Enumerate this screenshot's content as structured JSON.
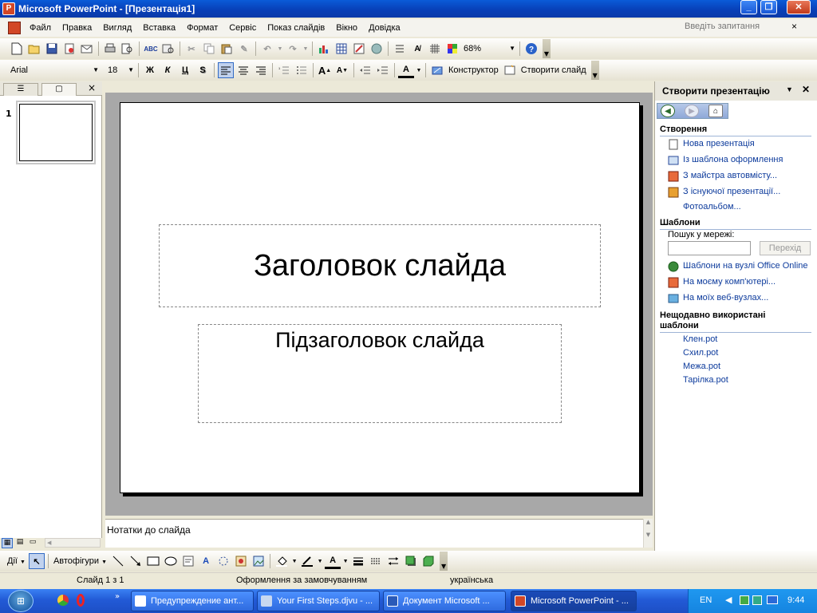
{
  "window": {
    "title": "Microsoft PowerPoint - [Презентація1]",
    "app_icon_letter": "P"
  },
  "menu": {
    "items": [
      "Файл",
      "Правка",
      "Вигляд",
      "Вставка",
      "Формат",
      "Сервіс",
      "Показ слайдів",
      "Вікно",
      "Довідка"
    ],
    "help_placeholder": "Введіть запитання",
    "close_symbol": "×"
  },
  "standard_toolbar": {
    "zoom": "68%"
  },
  "formatting_toolbar": {
    "font": "Arial",
    "size": "18",
    "bold": "Ж",
    "italic": "К",
    "underline": "Ц",
    "shadow": "S",
    "designer_label": "Конструктор",
    "new_slide_label": "Створити слайд"
  },
  "slides_panel": {
    "slide_number": "1",
    "close_symbol": "×"
  },
  "slide": {
    "title_placeholder": "Заголовок слайда",
    "subtitle_placeholder": "Підзаголовок слайда"
  },
  "notes": {
    "placeholder": "Нотатки до слайда"
  },
  "task_pane": {
    "title": "Створити презентацію",
    "section_new": "Створення",
    "new_links": [
      "Нова презентація",
      "Із шаблона оформлення",
      "З майстра автовмісту...",
      "З існуючої презентації...",
      "Фотоальбом..."
    ],
    "section_templates": "Шаблони",
    "search_label": "Пошук у мережі:",
    "go_button": "Перехід",
    "template_links": [
      "Шаблони на вузлі Office Online",
      "На моєму комп'ютері...",
      "На моїх веб-вузлах..."
    ],
    "section_recent": "Нещодавно використані шаблони",
    "recent_templates": [
      "Клен.pot",
      "Схил.pot",
      "Межа.pot",
      "Тарілка.pot"
    ]
  },
  "drawing_toolbar": {
    "actions_label": "Дії",
    "autoshapes_label": "Автофігури"
  },
  "status_bar": {
    "slide": "Слайд 1 з 1",
    "design": "Оформлення за замовчуванням",
    "language": "українська"
  },
  "taskbar": {
    "tasks": [
      "Предупреждение ант...",
      "Your First Steps.djvu - ...",
      "Документ Microsoft ...",
      "Microsoft PowerPoint - ..."
    ],
    "lang": "EN",
    "clock": "9:44"
  }
}
